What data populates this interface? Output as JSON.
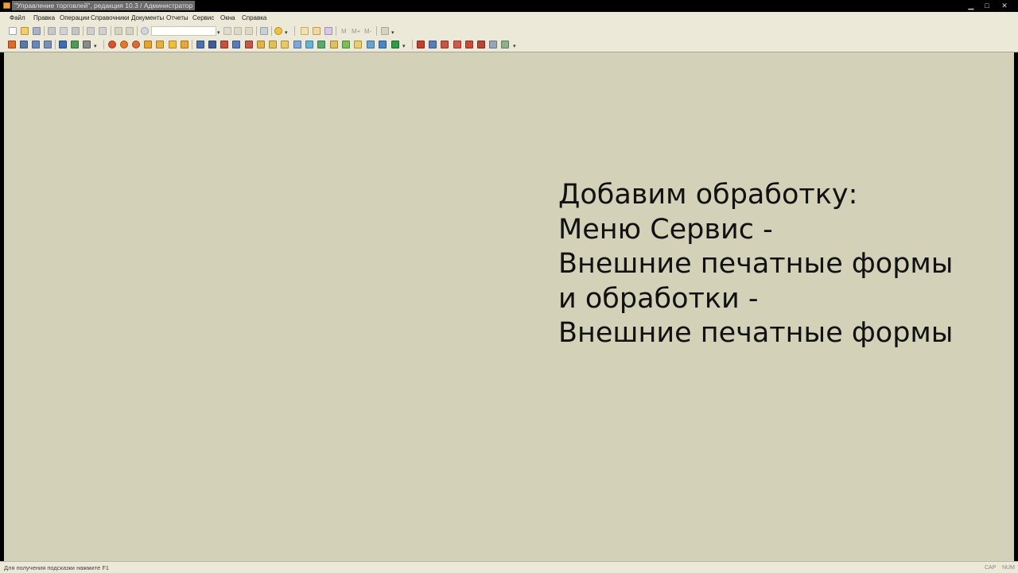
{
  "window": {
    "title": "\"Управление торговлей\", редакция 10.3 / Администратор",
    "min_glyph": "▁",
    "max_glyph": "□",
    "close_glyph": "✕"
  },
  "menu": {
    "items": [
      "Файл",
      "Правка",
      "Операции",
      "Справочники",
      "Документы",
      "Отчеты",
      "Сервис",
      "Окна",
      "Справка"
    ]
  },
  "toolbar1": {
    "search_value": "",
    "m_labels": [
      "M",
      "M+",
      "M-"
    ]
  },
  "content": {
    "instruction_lines": [
      "Добавим обработку:",
      "Меню Сервис -",
      "Внешние печатные формы",
      "и обработки -",
      "Внешние печатные формы"
    ]
  },
  "statusbar": {
    "hint": "Для получения подсказки нажмите F1",
    "cap": "CAP",
    "num": "NUM"
  },
  "colors": {
    "workspace": "#d4d1b9",
    "chrome": "#ece9d8",
    "titlebar": "#000000"
  }
}
